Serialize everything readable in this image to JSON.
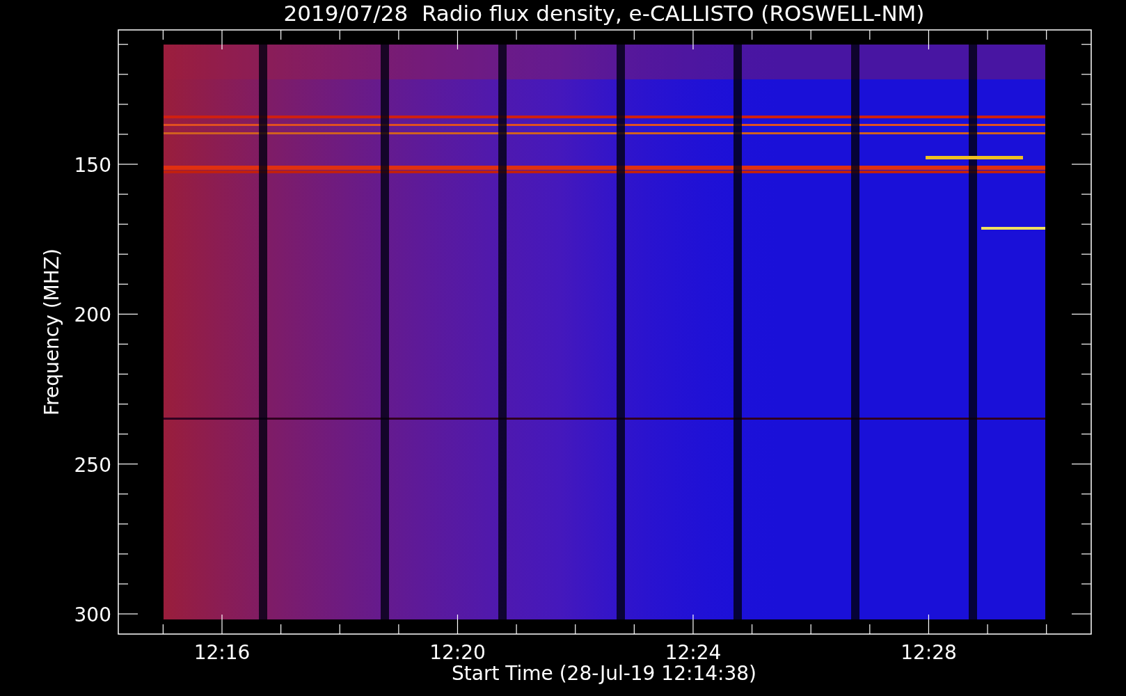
{
  "title": "2019/07/28  Radio flux density, e-CALLISTO (ROSWELL-NM)",
  "y_axis": {
    "label": "Frequency (MHZ)",
    "ticks": [
      "150",
      "200",
      "250",
      "300"
    ]
  },
  "x_axis": {
    "label": "Start Time (28-Jul-19 12:14:38)",
    "ticks": [
      "12:16",
      "12:20",
      "12:24",
      "12:28"
    ]
  }
}
